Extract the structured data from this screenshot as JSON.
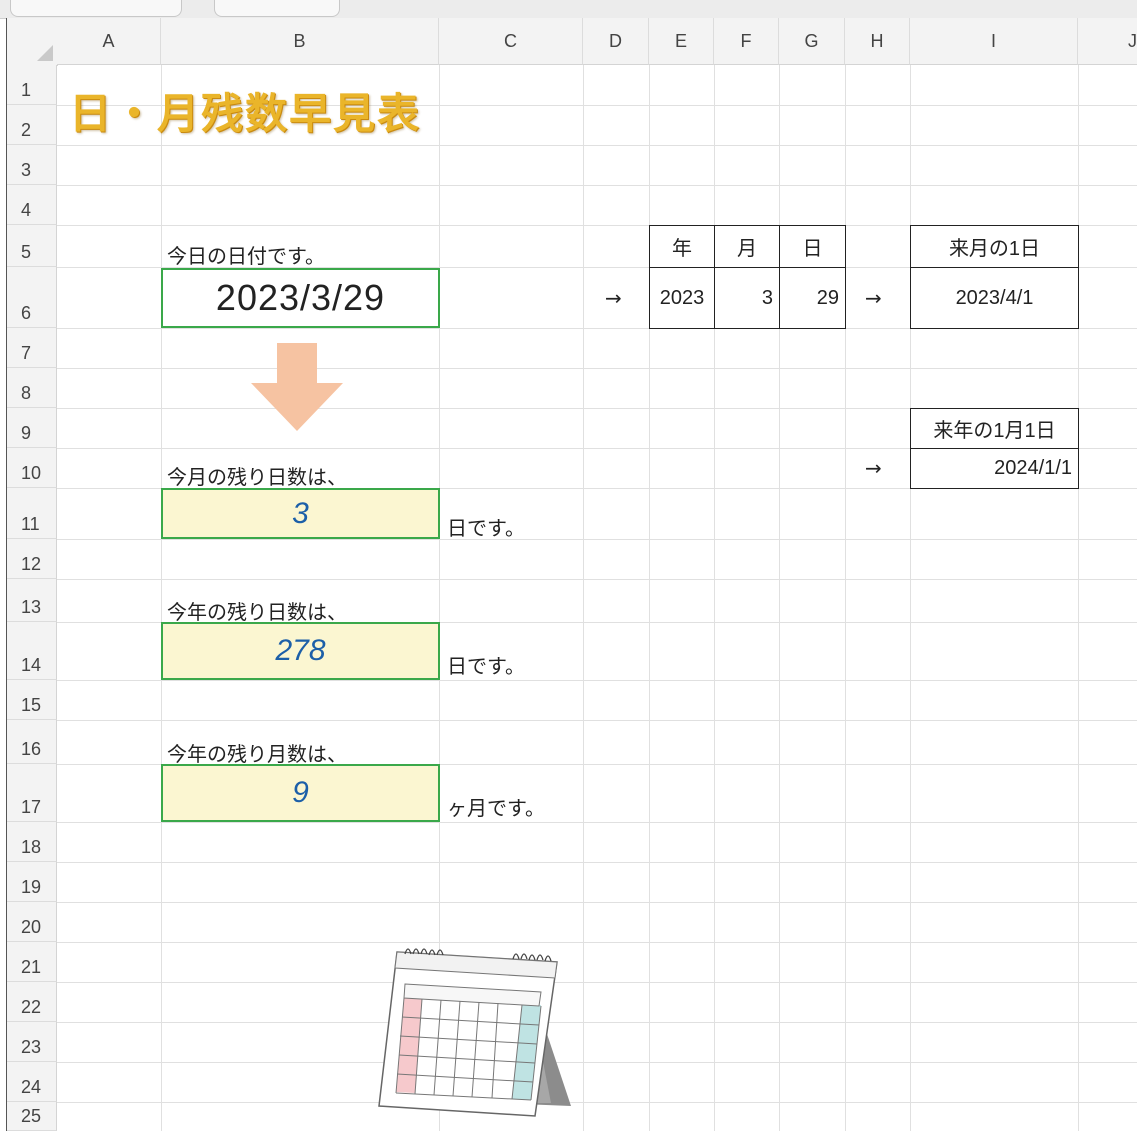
{
  "columns": [
    "A",
    "B",
    "C",
    "D",
    "E",
    "F",
    "G",
    "H",
    "I",
    "J"
  ],
  "rows": [
    "1",
    "2",
    "3",
    "4",
    "5",
    "6",
    "7",
    "8",
    "9",
    "10",
    "11",
    "12",
    "13",
    "14",
    "15",
    "16",
    "17",
    "18",
    "19",
    "20",
    "21",
    "22",
    "23",
    "24",
    "25"
  ],
  "title": "日・月残数早見表",
  "today": {
    "label": "今日の日付です。",
    "value": "2023/3/29"
  },
  "date_parts": {
    "headers": [
      "年",
      "月",
      "日"
    ],
    "values": [
      "2023",
      "3",
      "29"
    ]
  },
  "arrow_glyph": "→",
  "next_month": {
    "header": "来月の1日",
    "value": "2023/4/1"
  },
  "next_year": {
    "header": "来年の1月1日",
    "value": "2024/1/1"
  },
  "month_remaining": {
    "label": "今月の残り日数は、",
    "value": "3",
    "suffix": "日です。"
  },
  "year_days_remaining": {
    "label": "今年の残り日数は、",
    "value": "278",
    "suffix": "日です。"
  },
  "year_months_remaining": {
    "label": "今年の残り月数は、",
    "value": "9",
    "suffix": "ヶ月です。"
  },
  "colors": {
    "title": "#eab52a",
    "box_border": "#3aa84a",
    "result_fill": "#fbf6d1",
    "result_text": "#1c5fa8",
    "down_arrow": "#f6c3a2"
  },
  "icons": [
    "down-arrow-icon",
    "desk-calendar-icon"
  ]
}
